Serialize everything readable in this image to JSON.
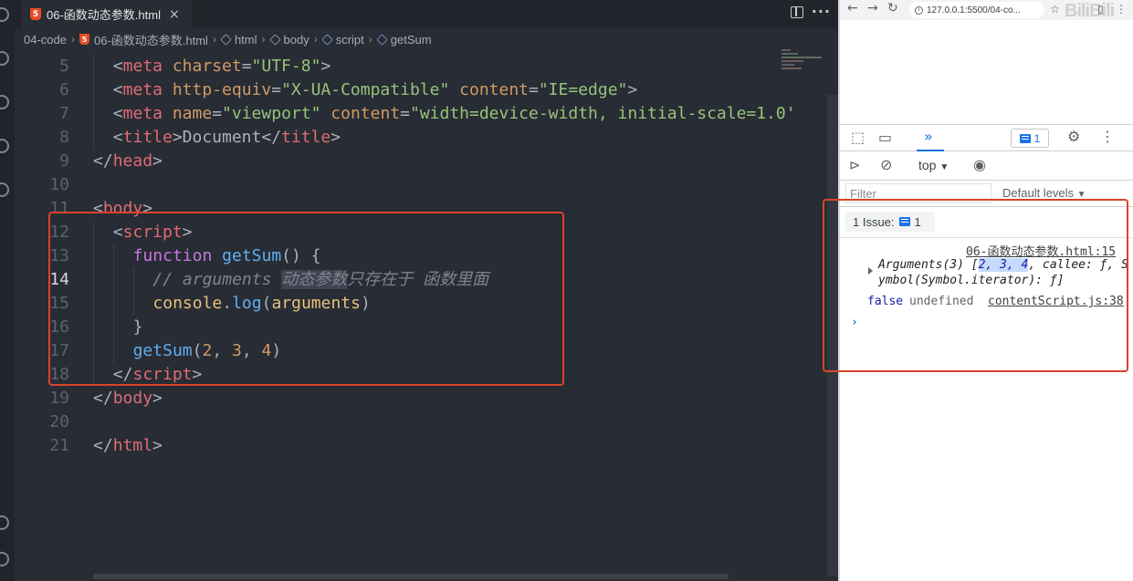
{
  "editor": {
    "tab": {
      "filename": "06-函数动态参数.html",
      "close": "×"
    },
    "breadcrumb": [
      "04-code",
      "06-函数动态参数.html",
      "html",
      "body",
      "script",
      "getSum"
    ],
    "lines": [
      {
        "n": "5",
        "active": false,
        "indent": 1,
        "tokens": [
          [
            "pun",
            "<"
          ],
          [
            "tag",
            "meta"
          ],
          [
            "pun",
            " "
          ],
          [
            "attr",
            "charset"
          ],
          [
            "pun",
            "="
          ],
          [
            "str",
            "\"UTF-8\""
          ],
          [
            "pun",
            ">"
          ]
        ]
      },
      {
        "n": "6",
        "active": false,
        "indent": 1,
        "tokens": [
          [
            "pun",
            "<"
          ],
          [
            "tag",
            "meta"
          ],
          [
            "pun",
            " "
          ],
          [
            "attr",
            "http-equiv"
          ],
          [
            "pun",
            "="
          ],
          [
            "str",
            "\"X-UA-Compatible\""
          ],
          [
            "pun",
            " "
          ],
          [
            "attr",
            "content"
          ],
          [
            "pun",
            "="
          ],
          [
            "str",
            "\"IE=edge\""
          ],
          [
            "pun",
            ">"
          ]
        ]
      },
      {
        "n": "7",
        "active": false,
        "indent": 1,
        "tokens": [
          [
            "pun",
            "<"
          ],
          [
            "tag",
            "meta"
          ],
          [
            "pun",
            " "
          ],
          [
            "attr",
            "name"
          ],
          [
            "pun",
            "="
          ],
          [
            "str",
            "\"viewport\""
          ],
          [
            "pun",
            " "
          ],
          [
            "attr",
            "content"
          ],
          [
            "pun",
            "="
          ],
          [
            "str",
            "\"width=device-width, initial-scale=1.0'"
          ]
        ]
      },
      {
        "n": "8",
        "active": false,
        "indent": 1,
        "tokens": [
          [
            "pun",
            "<"
          ],
          [
            "tag",
            "title"
          ],
          [
            "pun",
            ">Document</"
          ],
          [
            "tag",
            "title"
          ],
          [
            "pun",
            ">"
          ]
        ]
      },
      {
        "n": "9",
        "active": false,
        "indent": 0,
        "tokens": [
          [
            "pun",
            "</"
          ],
          [
            "tag",
            "head"
          ],
          [
            "pun",
            ">"
          ]
        ]
      },
      {
        "n": "10",
        "active": false,
        "indent": 0,
        "tokens": []
      },
      {
        "n": "11",
        "active": false,
        "indent": 0,
        "tokens": [
          [
            "pun",
            "<"
          ],
          [
            "tag",
            "body"
          ],
          [
            "pun",
            ">"
          ]
        ]
      },
      {
        "n": "12",
        "active": false,
        "indent": 1,
        "tokens": [
          [
            "pun",
            "<"
          ],
          [
            "tag",
            "script"
          ],
          [
            "pun",
            ">"
          ]
        ]
      },
      {
        "n": "13",
        "active": false,
        "indent": 2,
        "tokens": [
          [
            "kw",
            "function"
          ],
          [
            "pun",
            " "
          ],
          [
            "fn",
            "getSum"
          ],
          [
            "pun",
            "() {"
          ]
        ]
      },
      {
        "n": "14",
        "active": true,
        "indent": 3,
        "tokens": [
          [
            "com",
            "// arguments "
          ],
          [
            "comhl",
            "动态参数"
          ],
          [
            "com",
            "只存在于 函数里面"
          ]
        ]
      },
      {
        "n": "15",
        "active": false,
        "indent": 3,
        "tokens": [
          [
            "var",
            "console"
          ],
          [
            "pun",
            "."
          ],
          [
            "fn",
            "log"
          ],
          [
            "pun",
            "("
          ],
          [
            "var",
            "arguments"
          ],
          [
            "pun",
            ")"
          ]
        ]
      },
      {
        "n": "16",
        "active": false,
        "indent": 2,
        "tokens": [
          [
            "pun",
            "}"
          ]
        ]
      },
      {
        "n": "17",
        "active": false,
        "indent": 2,
        "tokens": [
          [
            "fn",
            "getSum"
          ],
          [
            "pun",
            "("
          ],
          [
            "num",
            "2"
          ],
          [
            "pun",
            ", "
          ],
          [
            "num",
            "3"
          ],
          [
            "pun",
            ", "
          ],
          [
            "num",
            "4"
          ],
          [
            "pun",
            ")"
          ]
        ]
      },
      {
        "n": "18",
        "active": false,
        "indent": 1,
        "tokens": [
          [
            "pun",
            "</"
          ],
          [
            "tag",
            "script"
          ],
          [
            "pun",
            ">"
          ]
        ]
      },
      {
        "n": "19",
        "active": false,
        "indent": 0,
        "tokens": [
          [
            "pun",
            "</"
          ],
          [
            "tag",
            "body"
          ],
          [
            "pun",
            ">"
          ]
        ]
      },
      {
        "n": "20",
        "active": false,
        "indent": 0,
        "tokens": []
      },
      {
        "n": "21",
        "active": false,
        "indent": 0,
        "tokens": [
          [
            "pun",
            "</"
          ],
          [
            "tag",
            "html"
          ],
          [
            "pun",
            ">"
          ]
        ]
      }
    ]
  },
  "browser": {
    "url": "127.0.0.1:5500/04-co...",
    "watermark": "BiliBili",
    "devtools": {
      "issues_count": "1",
      "context": "top",
      "filter_placeholder": "Filter",
      "levels": "Default levels",
      "issues_label": "1 Issue:",
      "issues_badge_count": "1"
    },
    "console": {
      "source1": "06-函数动态参数.html:15",
      "args_prefix": "Arguments(3) [",
      "args_values": "2, 3, 4",
      "args_suffix": ", callee: ƒ, S",
      "args_line2": "ymbol(Symbol.iterator): ƒ]",
      "false_text": "false",
      "undefined_text": "undefined",
      "source2": "contentScript.js:38",
      "prompt": "›"
    }
  }
}
